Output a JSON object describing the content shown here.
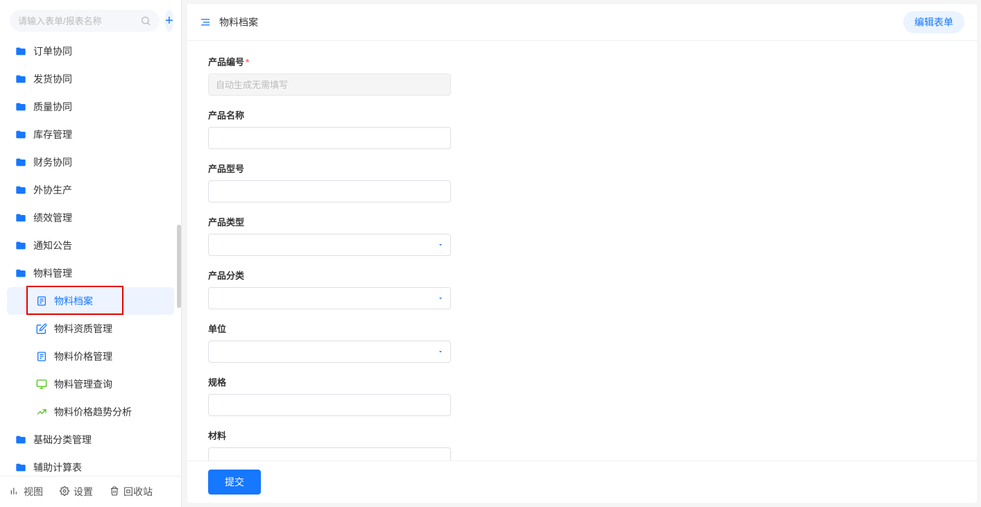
{
  "sidebar": {
    "search_placeholder": "请输入表单/报表名称",
    "items": [
      {
        "label": "订单协同",
        "type": "folder"
      },
      {
        "label": "发货协同",
        "type": "folder"
      },
      {
        "label": "质量协同",
        "type": "folder"
      },
      {
        "label": "库存管理",
        "type": "folder"
      },
      {
        "label": "财务协同",
        "type": "folder"
      },
      {
        "label": "外协生产",
        "type": "folder"
      },
      {
        "label": "绩效管理",
        "type": "folder"
      },
      {
        "label": "通知公告",
        "type": "folder"
      },
      {
        "label": "物料管理",
        "type": "folder"
      },
      {
        "label": "物料档案",
        "type": "sub-form",
        "active": true,
        "highlighted": true,
        "icon": "form",
        "icon_color": "#1677ff"
      },
      {
        "label": "物料资质管理",
        "type": "sub-form",
        "icon": "edit",
        "icon_color": "#1677ff"
      },
      {
        "label": "物料价格管理",
        "type": "sub-form",
        "icon": "form",
        "icon_color": "#1677ff"
      },
      {
        "label": "物料管理查询",
        "type": "sub-form",
        "icon": "monitor",
        "icon_color": "#52c41a"
      },
      {
        "label": "物料价格趋势分析",
        "type": "sub-form",
        "icon": "chart",
        "icon_color": "#52c41a"
      },
      {
        "label": "基础分类管理",
        "type": "folder"
      },
      {
        "label": "辅助计算表",
        "type": "folder"
      }
    ],
    "footer": {
      "view": "视图",
      "settings": "设置",
      "trash": "回收站"
    }
  },
  "header": {
    "title": "物料档案",
    "edit_button": "编辑表单"
  },
  "form": {
    "fields": [
      {
        "label": "产品编号",
        "required": true,
        "type": "text",
        "disabled": true,
        "placeholder": "自动生成无需填写"
      },
      {
        "label": "产品名称",
        "required": false,
        "type": "text"
      },
      {
        "label": "产品型号",
        "required": false,
        "type": "text"
      },
      {
        "label": "产品类型",
        "required": false,
        "type": "select"
      },
      {
        "label": "产品分类",
        "required": false,
        "type": "select"
      },
      {
        "label": "单位",
        "required": false,
        "type": "select"
      },
      {
        "label": "规格",
        "required": false,
        "type": "text"
      },
      {
        "label": "材料",
        "required": false,
        "type": "text"
      }
    ],
    "submit_label": "提交"
  }
}
